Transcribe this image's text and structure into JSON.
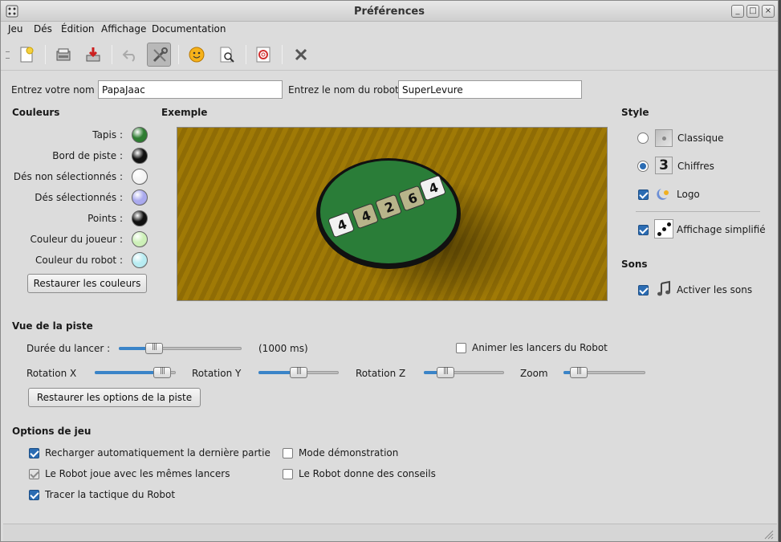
{
  "window": {
    "title": "Préférences"
  },
  "menu": [
    "Jeu",
    "Dés",
    "Édition",
    "Affichage",
    "Documentation"
  ],
  "toolbar": {
    "icons": [
      "new-game-icon",
      "open-icon",
      "save-icon",
      "undo-icon",
      "preferences-icon",
      "smiley-icon",
      "search-icon",
      "help-icon",
      "quit-icon"
    ]
  },
  "names": {
    "player_label": "Entrez votre nom :",
    "player_value": "PapaJaac",
    "robot_label": "Entrez le nom du robot :",
    "robot_value": "SuperLevure"
  },
  "couleurs": {
    "heading": "Couleurs",
    "items": [
      {
        "label": "Tapis :",
        "color": "#2e7d32"
      },
      {
        "label": "Bord de piste :",
        "color": "#111111"
      },
      {
        "label": "Dés non sélectionnés :",
        "color": "#f4f4f4"
      },
      {
        "label": "Dés sélectionnés :",
        "color": "#aaaaee"
      },
      {
        "label": "Points :",
        "color": "#111111"
      },
      {
        "label": "Couleur du joueur :",
        "color": "#cdf0b8"
      },
      {
        "label": "Couleur du robot :",
        "color": "#b8ecf2"
      }
    ],
    "reset_button": "Restaurer les couleurs"
  },
  "exemple": {
    "heading": "Exemple",
    "dice": [
      "4",
      "4",
      "2",
      "6",
      "4"
    ]
  },
  "style": {
    "heading": "Style",
    "options": [
      {
        "label": "Classique",
        "selected": false
      },
      {
        "label": "Chiffres",
        "selected": true
      }
    ],
    "chiffres_icon_text": "3",
    "logo_label": "Logo",
    "logo_checked": true,
    "simplified_label": "Affichage simplifié",
    "simplified_checked": true
  },
  "sons": {
    "heading": "Sons",
    "enable_label": "Activer les sons",
    "enabled": true
  },
  "piste": {
    "heading": "Vue de la piste",
    "duration_label": "Durée du lancer :",
    "duration_value": "(1000 ms)",
    "duration_level": 0.25,
    "animate_label": "Animer les lancers du Robot",
    "animate_checked": false,
    "rotation_x_label": "Rotation X",
    "rotation_x_level": 0.92,
    "rotation_y_label": "Rotation Y",
    "rotation_y_level": 0.5,
    "rotation_z_label": "Rotation Z",
    "rotation_z_level": 0.2,
    "zoom_label": "Zoom",
    "zoom_level": 0.1,
    "reset_button": "Restaurer les options de la piste"
  },
  "options": {
    "heading": "Options de jeu",
    "items": [
      {
        "label": "Recharger automatiquement la dernière partie",
        "state": "on"
      },
      {
        "label": "Le Robot joue avec les mêmes lancers",
        "state": "gray"
      },
      {
        "label": "Tracer la tactique du Robot",
        "state": "on"
      },
      {
        "label": "Mode démonstration",
        "state": "off"
      },
      {
        "label": "Le Robot donne des conseils",
        "state": "off"
      }
    ]
  }
}
